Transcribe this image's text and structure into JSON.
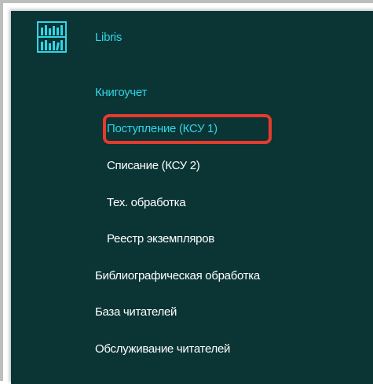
{
  "app": {
    "title": "Libris",
    "logo_icon": "library-books-icon"
  },
  "menu": {
    "section_label": "Книгоучет",
    "sub_items": [
      {
        "label": "Поступление (КСУ 1)",
        "active": true
      },
      {
        "label": "Списание (КСУ 2)"
      },
      {
        "label": "Тех. обработка"
      },
      {
        "label": "Реестр экземпляров"
      }
    ],
    "top_items": [
      {
        "label": "Библиографическая обработка"
      },
      {
        "label": "База читателей"
      },
      {
        "label": "Обслуживание читателей"
      }
    ]
  },
  "colors": {
    "sidebar_bg": "#0b3434",
    "accent": "#2fd6e6",
    "text": "#ffffff",
    "highlight_border": "#e53a2e"
  }
}
